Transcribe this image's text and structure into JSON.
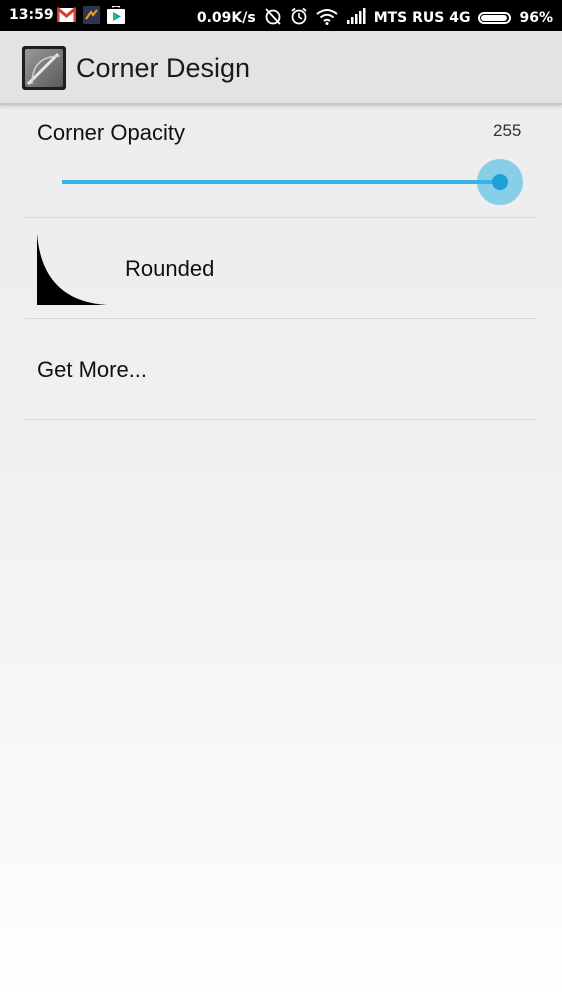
{
  "status_bar": {
    "time": "13:59",
    "speed": "0.09K/s",
    "carrier": "MTS RUS 4G",
    "battery_percent": "96%",
    "battery_level": 0.96,
    "notification_icons": [
      "gmail-icon",
      "app-notification-icon",
      "play-store-icon"
    ],
    "system_icons": [
      "alarm-off-icon",
      "alarm-clock-icon",
      "wifi-icon",
      "signal-icon",
      "battery-icon"
    ]
  },
  "action_bar": {
    "title": "Corner Design",
    "icon": "corner-design-app-icon"
  },
  "opacity_pref": {
    "label": "Corner Opacity",
    "value": "255",
    "slider_fraction": 1.0,
    "accent_color": "#33b5e5"
  },
  "style_pref": {
    "label": "Rounded",
    "icon": "rounded-corner-preview-icon"
  },
  "more_pref": {
    "label": "Get More..."
  }
}
